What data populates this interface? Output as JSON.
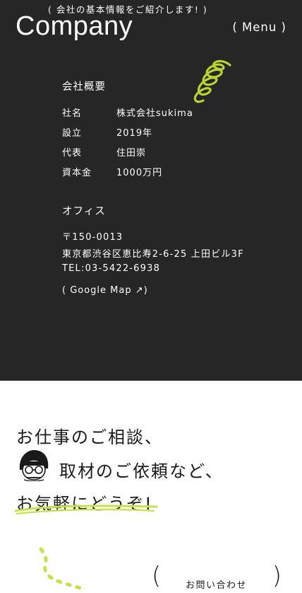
{
  "header": {
    "subtitle": "( 会社の基本情報をご紹介します! )",
    "brand": "Company",
    "menu_label": "( Menu )"
  },
  "company_overview": {
    "title": "会社概要",
    "rows": [
      {
        "label": "社名",
        "value": "株式会社sukima"
      },
      {
        "label": "設立",
        "value": "2019年"
      },
      {
        "label": "代表",
        "value": "住田崇"
      },
      {
        "label": "資本金",
        "value": "1000万円"
      }
    ]
  },
  "office": {
    "title": "オフィス",
    "postal": "〒150-0013",
    "address": "東京都渋谷区恵比寿2-6-25 上田ビル3F",
    "tel": "TEL:03-5422-6938",
    "map_link": "( Google Map ↗)"
  },
  "cta": {
    "line1": "お仕事のご相談、",
    "line2": "取材のご依頼など、",
    "line3": "お気軽にどうぞ!",
    "contact_label": "お問い合わせ"
  },
  "icons": [
    "spring-doodle-icon",
    "face-illustration-icon",
    "highlight-underline-icon",
    "dotted-trail-icon"
  ],
  "colors": {
    "dark_bg": "#262626",
    "accent": "#b7d432",
    "text_light": "#ffffff",
    "text_dark": "#1a1a1a"
  }
}
